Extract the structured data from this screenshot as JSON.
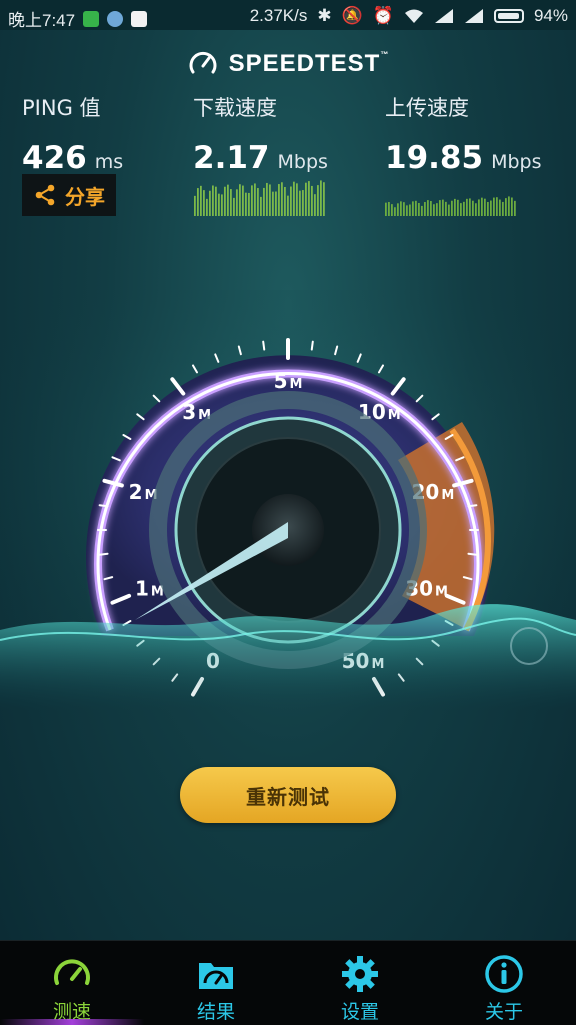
{
  "status_bar": {
    "time": "晚上7:47",
    "net_speed": "2.37K/s",
    "battery": "94%"
  },
  "app": {
    "logo_text": "SPEEDTEST",
    "logo_tm": "™"
  },
  "metrics": {
    "ping": {
      "label": "PING 值",
      "value": "426",
      "unit": "ms"
    },
    "download": {
      "label": "下载速度",
      "value": "2.17",
      "unit": "Mbps"
    },
    "upload": {
      "label": "上传速度",
      "value": "19.85",
      "unit": "Mbps"
    }
  },
  "share_label": "分享",
  "gauge": {
    "ticks": [
      {
        "num": "0",
        "suffix": ""
      },
      {
        "num": "1",
        "suffix": "M"
      },
      {
        "num": "2",
        "suffix": "M"
      },
      {
        "num": "3",
        "suffix": "M"
      },
      {
        "num": "5",
        "suffix": "M"
      },
      {
        "num": "10",
        "suffix": "M"
      },
      {
        "num": "20",
        "suffix": "M"
      },
      {
        "num": "30",
        "suffix": "M"
      },
      {
        "num": "50",
        "suffix": "M"
      }
    ],
    "needle_value_mbps": 0
  },
  "retest_label": "重新测试",
  "tabs": [
    {
      "label": "测速",
      "icon": "speedometer-icon",
      "active": true
    },
    {
      "label": "结果",
      "icon": "folder-icon",
      "active": false
    },
    {
      "label": "设置",
      "icon": "gear-icon",
      "active": false
    },
    {
      "label": "关于",
      "icon": "info-icon",
      "active": false
    }
  ],
  "colors": {
    "accent_orange": "#f4a62a",
    "tab_blue": "#2cc8e8",
    "tab_active_green": "#8bd43a",
    "gauge_purple": "#b77cff"
  }
}
